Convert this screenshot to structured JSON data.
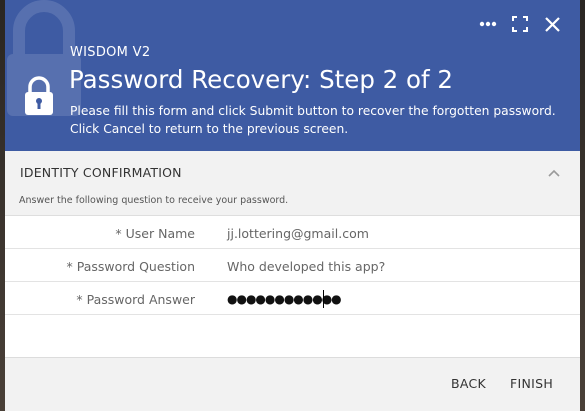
{
  "header": {
    "app_name": "WISDOM V2",
    "title": "Password Recovery: Step 2 of 2",
    "subtitle": "Please fill this form and click Submit button to recover the forgotten password. Click Cancel to return to the previous screen.",
    "color": "#3e5ba3"
  },
  "window_controls": {
    "more_icon": "more-horizontal-icon",
    "maximize_icon": "maximize-icon",
    "close_icon": "close-icon"
  },
  "section": {
    "title": "IDENTITY CONFIRMATION",
    "hint": "Answer the following question to receive your password.",
    "collapse_icon": "chevron-up-icon"
  },
  "form": {
    "fields": [
      {
        "label": "* User Name",
        "value": "jj.lottering@gmail.com"
      },
      {
        "label": "* Password Question",
        "value": "Who developed this app?"
      },
      {
        "label": "* Password Answer",
        "value": "●●●●●●●●●●●●"
      }
    ]
  },
  "footer": {
    "back_label": "BACK",
    "finish_label": "FINISH"
  }
}
